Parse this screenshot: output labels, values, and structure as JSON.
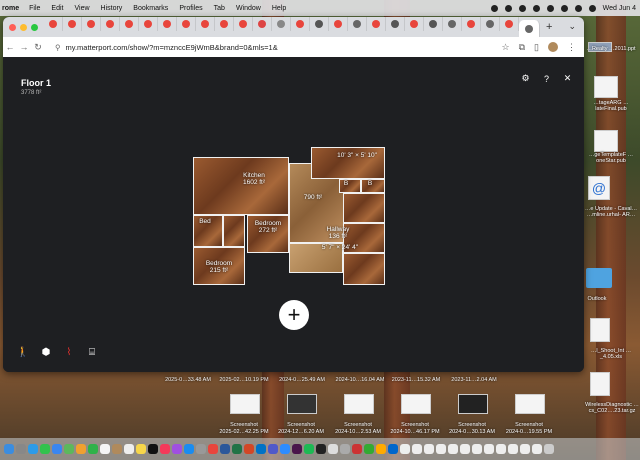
{
  "menubar": {
    "app": "rome",
    "items": [
      "File",
      "Edit",
      "View",
      "History",
      "Bookmarks",
      "Profiles",
      "Tab",
      "Window",
      "Help"
    ],
    "clock": "Wed Jun 4"
  },
  "browser": {
    "tab_count": 31,
    "url": "my.matterport.com/show/?m=mznccE9jWmB&brand=0&mls=1&",
    "new_tab": "+",
    "tab_menu": "⌄"
  },
  "viewer": {
    "floor": "Floor 1",
    "area": "3778 ft²",
    "rooms": [
      {
        "name": "Kitchen",
        "size": "1602 ft²"
      },
      {
        "name": "Bed",
        "size": ""
      },
      {
        "name": "Bedroom",
        "size": "272 ft²"
      },
      {
        "name": "Bedroom",
        "size": "215 ft²"
      },
      {
        "name": "",
        "size": "790 ft²"
      },
      {
        "name": "Hallway",
        "size": "136 ft²"
      },
      {
        "name": "",
        "size": "5' 7\" × 24' 4\""
      },
      {
        "name": "",
        "size": "10' 3\" × 5' 10\""
      },
      {
        "name": "B",
        "size": ""
      },
      {
        "name": "B",
        "size": ""
      }
    ],
    "help": "?",
    "close": "✕"
  },
  "desktop": {
    "right_files": [
      {
        "label": "…Realty …2011.ppt"
      },
      {
        "label": "…tageARG …lateFinal.pub"
      },
      {
        "label": "…geTemplateF …oneStar.pub"
      },
      {
        "label": "…e Update - Caval… …mline.urhal- AR…"
      },
      {
        "label": "Outlook"
      },
      {
        "label": "…l_Shoot_Int …_4.05.xls"
      },
      {
        "label": "WirelessDiagnostic …cs_C02….23.tar.gz"
      }
    ],
    "shot_row1": [
      "2025-0…33.48 AM",
      "2025-02…10.19 PM",
      "2024-0…25.49 AM",
      "2024-10…16.04 AM",
      "2023-11…15.32 AM",
      "2023-11…2.04 AM"
    ],
    "shot_row2": [
      {
        "title": "Screenshot",
        "date": "2025-02…42.25 PM"
      },
      {
        "title": "Screenshot",
        "date": "2024-12…6.20 AM"
      },
      {
        "title": "Screenshot",
        "date": "2024-10…2.53 AM"
      },
      {
        "title": "Screenshot",
        "date": "2024-10…46.17 PM"
      },
      {
        "title": "Screenshot",
        "date": "2024-0…30.13 AM"
      },
      {
        "title": "Screenshot",
        "date": "2024-0…19.55 PM"
      }
    ]
  }
}
